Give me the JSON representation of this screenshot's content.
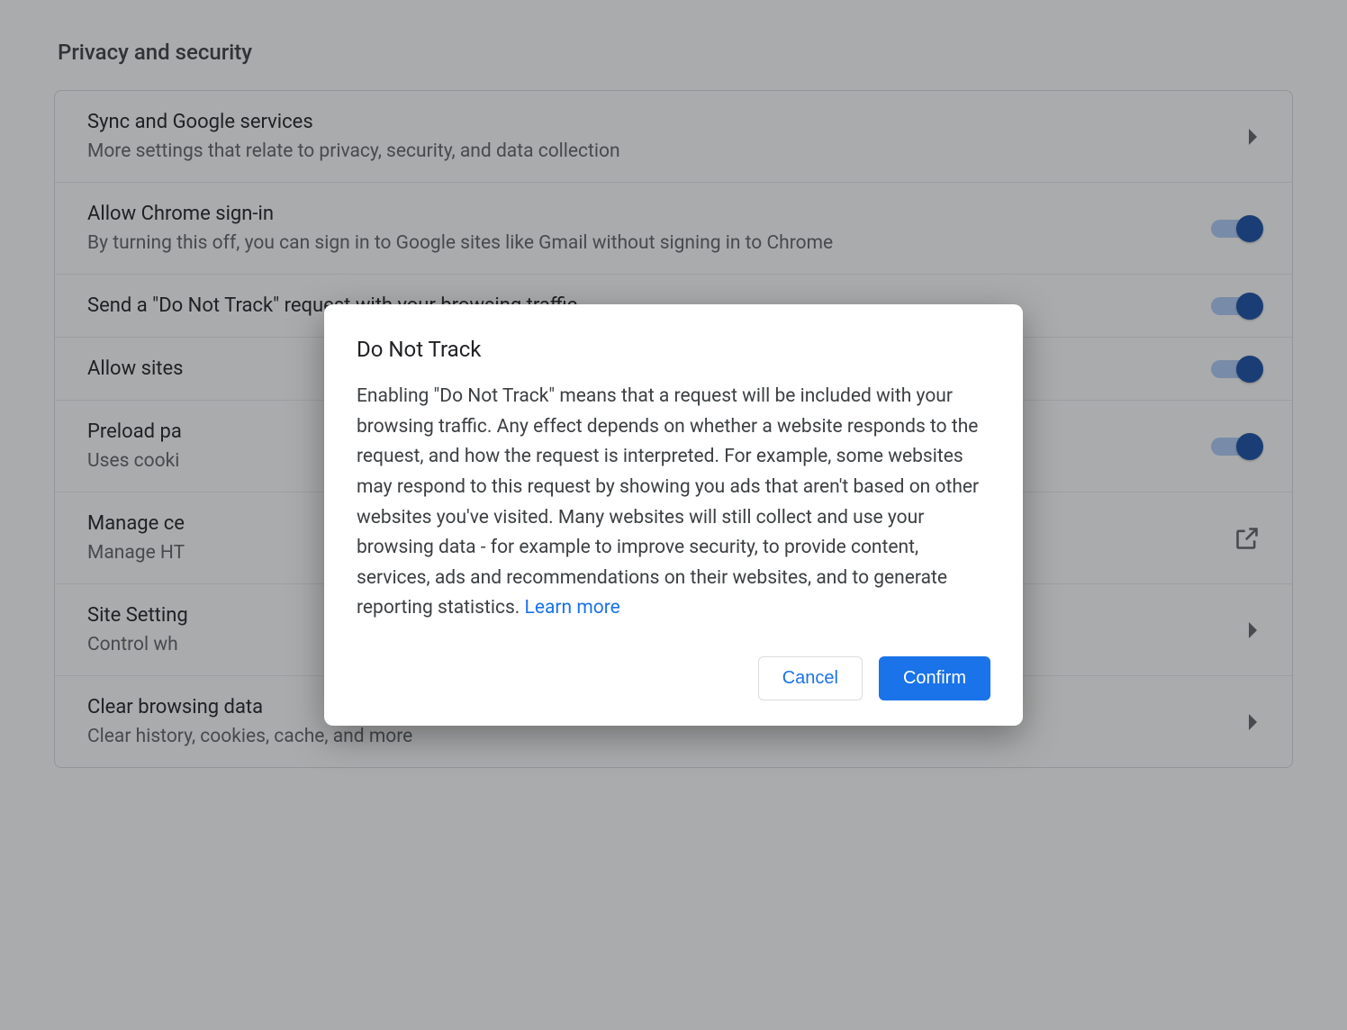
{
  "section": {
    "title": "Privacy and security"
  },
  "rows": {
    "sync": {
      "title": "Sync and Google services",
      "sub": "More settings that relate to privacy, security, and data collection"
    },
    "signin": {
      "title": "Allow Chrome sign-in",
      "sub": "By turning this off, you can sign in to Google sites like Gmail without signing in to Chrome"
    },
    "dnt": {
      "title": "Send a \"Do Not Track\" request with your browsing traffic"
    },
    "allowsites": {
      "title": "Allow sites"
    },
    "preload": {
      "title": "Preload pa",
      "sub": "Uses cooki"
    },
    "certs": {
      "title": "Manage ce",
      "sub": "Manage HT"
    },
    "site": {
      "title": "Site Setting",
      "sub": "Control wh"
    },
    "clear": {
      "title": "Clear browsing data",
      "sub": "Clear history, cookies, cache, and more"
    }
  },
  "dialog": {
    "title": "Do Not Track",
    "body": "Enabling \"Do Not Track\" means that a request will be included with your browsing traffic. Any effect depends on whether a website responds to the request, and how the request is interpreted. For example, some websites may respond to this request by showing you ads that aren't based on other websites you've visited. Many websites will still collect and use your browsing data - for example to improve security, to provide content, services, ads and recommendations on their websites, and to generate reporting statistics. ",
    "learn_more": "Learn more",
    "cancel": "Cancel",
    "confirm": "Confirm"
  }
}
